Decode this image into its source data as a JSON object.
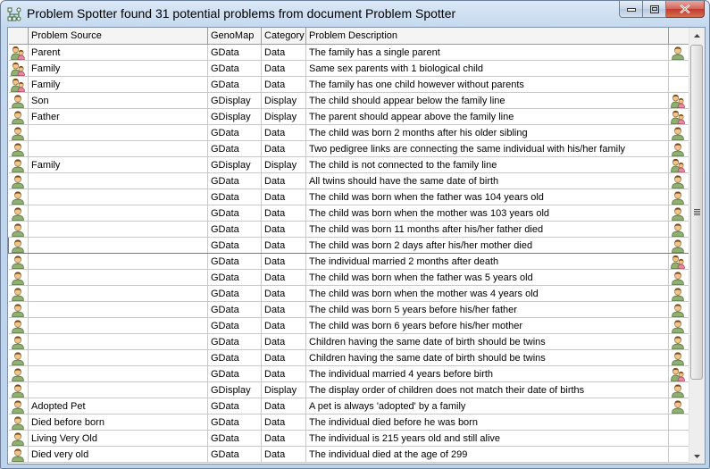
{
  "window": {
    "title": "Problem Spotter found 31 potential problems from document Problem Spotter",
    "app_icon": "pedigree-icon",
    "controls": [
      "minimize",
      "maximize",
      "close"
    ]
  },
  "table": {
    "columns": [
      "",
      "Problem Source",
      "GenoMap",
      "Category",
      "Problem Description",
      ""
    ],
    "selected_row_index": 12,
    "rows": [
      {
        "icon": "couple",
        "source": "Parent",
        "genomap": "GData",
        "category": "Data",
        "description": "The family has a single parent",
        "target_icon": "single"
      },
      {
        "icon": "couple",
        "source": "Family",
        "genomap": "GData",
        "category": "Data",
        "description": "Same sex parents with 1 biological child",
        "target_icon": ""
      },
      {
        "icon": "couple",
        "source": "Family",
        "genomap": "GData",
        "category": "Data",
        "description": "The family has one child however without parents",
        "target_icon": ""
      },
      {
        "icon": "single",
        "source": "Son",
        "genomap": "GDisplay",
        "category": "Display",
        "description": "The child should appear below the family line",
        "target_icon": "couple"
      },
      {
        "icon": "single",
        "source": "Father",
        "genomap": "GDisplay",
        "category": "Display",
        "description": "The parent should appear above the family line",
        "target_icon": "couple"
      },
      {
        "icon": "single",
        "source": "",
        "genomap": "GData",
        "category": "Data",
        "description": "The child was born 2 months after his older sibling",
        "target_icon": "single"
      },
      {
        "icon": "single",
        "source": "",
        "genomap": "GData",
        "category": "Data",
        "description": "Two pedigree links are connecting the same individual with his/her family",
        "target_icon": "single"
      },
      {
        "icon": "single",
        "source": "Family",
        "genomap": "GDisplay",
        "category": "Display",
        "description": "The child is not connected to the family line",
        "target_icon": "couple"
      },
      {
        "icon": "single",
        "source": "",
        "genomap": "GData",
        "category": "Data",
        "description": "All twins should have the same date of birth",
        "target_icon": "single"
      },
      {
        "icon": "single",
        "source": "",
        "genomap": "GData",
        "category": "Data",
        "description": "The child was born when the father was 104 years old",
        "target_icon": "single"
      },
      {
        "icon": "single",
        "source": "",
        "genomap": "GData",
        "category": "Data",
        "description": "The child was born when the mother was 103 years old",
        "target_icon": "single"
      },
      {
        "icon": "single",
        "source": "",
        "genomap": "GData",
        "category": "Data",
        "description": "The child was born 11 months after his/her father died",
        "target_icon": "single"
      },
      {
        "icon": "single",
        "source": "",
        "genomap": "GData",
        "category": "Data",
        "description": "The child was born 2 days after his/her mother died",
        "target_icon": "single"
      },
      {
        "icon": "single",
        "source": "",
        "genomap": "GData",
        "category": "Data",
        "description": "The individual married 2 months after death",
        "target_icon": "couple"
      },
      {
        "icon": "single",
        "source": "",
        "genomap": "GData",
        "category": "Data",
        "description": "The child was born when the father was 5 years old",
        "target_icon": "single"
      },
      {
        "icon": "single",
        "source": "",
        "genomap": "GData",
        "category": "Data",
        "description": "The child was born when the mother was 4 years old",
        "target_icon": "single"
      },
      {
        "icon": "single",
        "source": "",
        "genomap": "GData",
        "category": "Data",
        "description": "The child was born 5 years before his/her father",
        "target_icon": "single"
      },
      {
        "icon": "single",
        "source": "",
        "genomap": "GData",
        "category": "Data",
        "description": "The child was born 6 years before his/her mother",
        "target_icon": "single"
      },
      {
        "icon": "single",
        "source": "",
        "genomap": "GData",
        "category": "Data",
        "description": "Children having the same date of birth should be twins",
        "target_icon": "single"
      },
      {
        "icon": "single",
        "source": "",
        "genomap": "GData",
        "category": "Data",
        "description": "Children having the same date of birth should be twins",
        "target_icon": "single"
      },
      {
        "icon": "single",
        "source": "",
        "genomap": "GData",
        "category": "Data",
        "description": "The individual married 4 years before birth",
        "target_icon": "couple"
      },
      {
        "icon": "single",
        "source": "",
        "genomap": "GDisplay",
        "category": "Display",
        "description": "The display order of children does not match their date of births",
        "target_icon": "single"
      },
      {
        "icon": "single",
        "source": "Adopted Pet",
        "genomap": "GData",
        "category": "Data",
        "description": "A pet is always 'adopted' by a family",
        "target_icon": "single"
      },
      {
        "icon": "single",
        "source": "Died before born",
        "genomap": "GData",
        "category": "Data",
        "description": "The individual died before he was born",
        "target_icon": ""
      },
      {
        "icon": "single",
        "source": "Living Very Old",
        "genomap": "GData",
        "category": "Data",
        "description": "The individual is 215 years old and still alive",
        "target_icon": ""
      },
      {
        "icon": "single",
        "source": "Died very old",
        "genomap": "GData",
        "category": "Data",
        "description": "The individual died at the age of 299",
        "target_icon": ""
      }
    ]
  },
  "scroll": {
    "position_fraction": 0.0,
    "visible_fraction": 0.84
  }
}
